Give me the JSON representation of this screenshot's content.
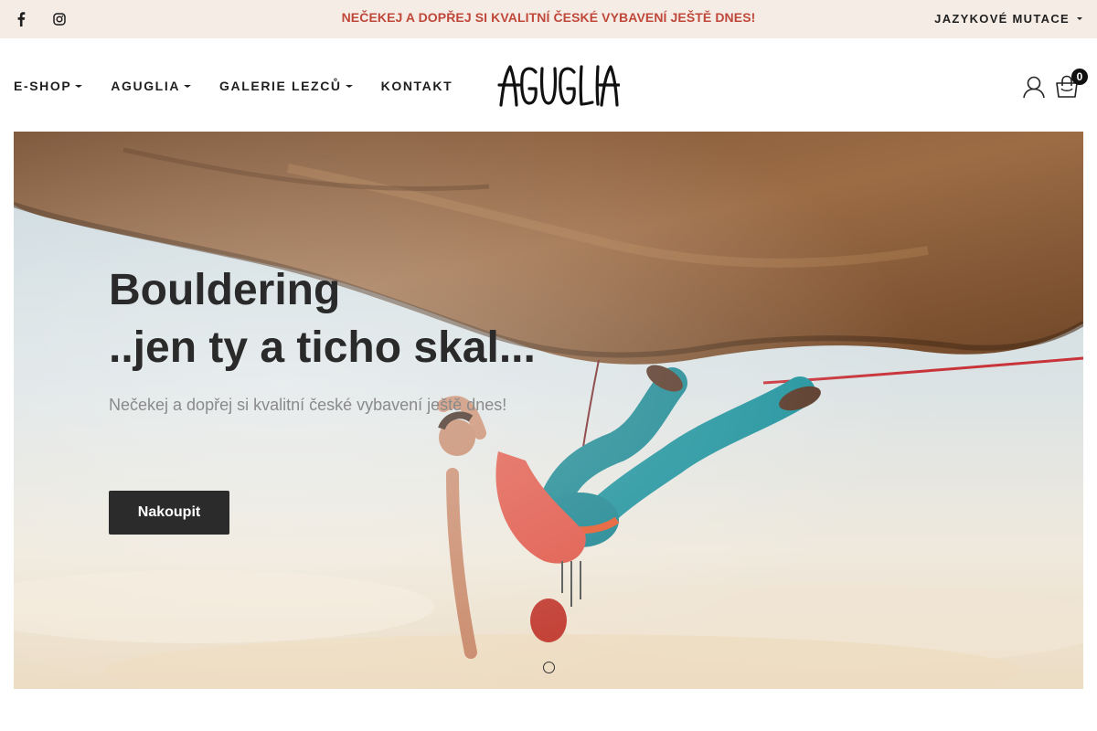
{
  "topbar": {
    "social": [
      {
        "name": "facebook-icon",
        "glyph": "f"
      },
      {
        "name": "instagram-icon"
      }
    ],
    "promo": "NEČEKEJ A DOPŘEJ SI KVALITNÍ ČESKÉ VYBAVENÍ JEŠTĚ DNES!",
    "language_label": "JAZYKOVÉ MUTACE",
    "promo_color": "#c0483a",
    "background": "#f5ece6"
  },
  "nav": {
    "items": [
      {
        "label": "E-SHOP",
        "has_dropdown": true
      },
      {
        "label": "AGUGLIA",
        "has_dropdown": true
      },
      {
        "label": "GALERIE LEZCŮ",
        "has_dropdown": true
      },
      {
        "label": "KONTAKT",
        "has_dropdown": false
      }
    ]
  },
  "logo": {
    "text": "AGUGLIA"
  },
  "cart": {
    "count": "0"
  },
  "hero": {
    "title": "Bouldering\n..jen ty a ticho skal...",
    "subtitle": "Nečekej a dopřej si kvalitní české vybavení ještě dnes!",
    "button_label": "Nakoupit",
    "slide_count": 1,
    "active_slide": 1
  }
}
